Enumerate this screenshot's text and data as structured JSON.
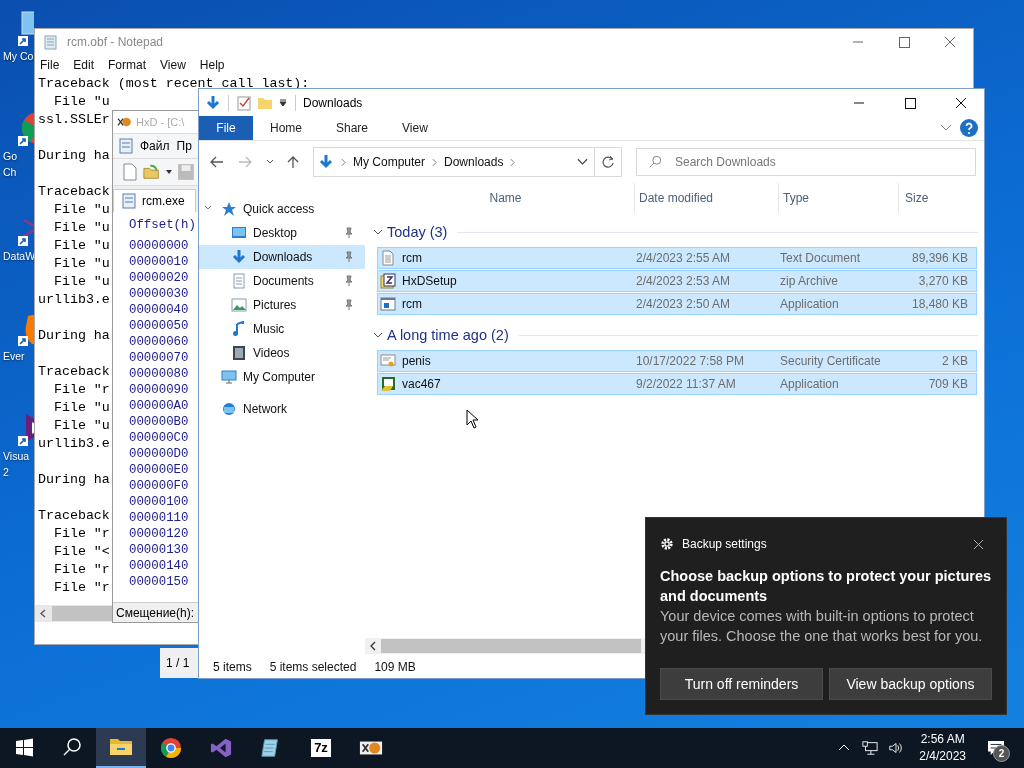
{
  "desktop_icons": [
    {
      "label_lines": [
        "My Co"
      ]
    },
    {
      "label_lines": [
        "Go",
        "Ch"
      ]
    },
    {
      "label_lines": [
        "DataW"
      ]
    },
    {
      "label_lines": [
        "Ever"
      ]
    },
    {
      "label_lines": [
        "Visua",
        "2"
      ]
    }
  ],
  "notepad": {
    "title": "rcm.obf - Notepad",
    "menu": [
      "File",
      "Edit",
      "Format",
      "View",
      "Help"
    ],
    "blocks": [
      [
        "Traceback (most recent call last):",
        "  File \"u",
        "ssl.SSLEr"
      ],
      [
        "During ha"
      ],
      [
        "Traceback",
        "  File \"u",
        "  File \"u",
        "  File \"u",
        "  File \"u",
        "  File \"u",
        "urllib3.e"
      ],
      [
        "During ha"
      ],
      [
        "Traceback",
        "  File \"r",
        "  File \"u",
        "  File \"u",
        "urllib3.e"
      ],
      [
        "During ha"
      ],
      [
        "Traceback",
        "  File \"r",
        "  File \"<",
        "  File \"r",
        "  File \"r"
      ]
    ]
  },
  "hxd": {
    "title": "HxD - [C:\\",
    "menu": [
      "Файл",
      "Пр"
    ],
    "tab": "rcm.exe",
    "offset_header": "Offset(h)",
    "offsets": [
      "00000000",
      "00000010",
      "00000020",
      "00000030",
      "00000040",
      "00000050",
      "00000060",
      "00000070",
      "00000080",
      "00000090",
      "000000A0",
      "000000B0",
      "000000C0",
      "000000D0",
      "000000E0",
      "000000F0",
      "00000100",
      "00000110",
      "00000120",
      "00000130",
      "00000140",
      "00000150"
    ],
    "status": "Смещение(h):",
    "page_status": "1 / 1"
  },
  "explorer": {
    "title": "Downloads",
    "ribbon_tabs": [
      {
        "label": "File",
        "selected": true
      },
      {
        "label": "Home",
        "selected": false
      },
      {
        "label": "Share",
        "selected": false
      },
      {
        "label": "View",
        "selected": false
      }
    ],
    "breadcrumb": [
      "My Computer",
      "Downloads"
    ],
    "search": {
      "placeholder": "Search Downloads"
    },
    "nav": [
      {
        "label": "Quick access",
        "expanded": true,
        "children": [
          {
            "label": "Desktop",
            "selected": false,
            "pinned": true
          },
          {
            "label": "Downloads",
            "selected": true,
            "pinned": true
          },
          {
            "label": "Documents",
            "selected": false,
            "pinned": true
          },
          {
            "label": "Pictures",
            "selected": false,
            "pinned": true
          },
          {
            "label": "Music",
            "selected": false,
            "pinned": false
          },
          {
            "label": "Videos",
            "selected": false,
            "pinned": false
          }
        ]
      },
      {
        "label": "My Computer"
      },
      {
        "label": "Network"
      }
    ],
    "columns": [
      "Name",
      "Date modified",
      "Type",
      "Size"
    ],
    "groups": [
      {
        "title": "Today (3)",
        "expanded": true,
        "rows": [
          {
            "kind": "text",
            "name": "rcm",
            "date": "2/4/2023 2:55 AM",
            "type": "Text Document",
            "size": "89,396 KB",
            "selected": true
          },
          {
            "kind": "zip",
            "name": "HxDSetup",
            "date": "2/4/2023 2:53 AM",
            "type": "zip Archive",
            "size": "3,270 KB",
            "selected": true
          },
          {
            "kind": "app",
            "name": "rcm",
            "date": "2/4/2023 2:50 AM",
            "type": "Application",
            "size": "18,480 KB",
            "selected": true
          }
        ]
      },
      {
        "title": "A long time ago (2)",
        "expanded": true,
        "rows": [
          {
            "kind": "cert",
            "name": "penis",
            "date": "10/17/2022 7:58 PM",
            "type": "Security Certificate",
            "size": "2 KB",
            "selected": true
          },
          {
            "kind": "setup",
            "name": "vac467",
            "date": "9/2/2022 11:37 AM",
            "type": "Application",
            "size": "709 KB",
            "selected": true
          }
        ]
      }
    ],
    "status": [
      "5 items",
      "5 items selected",
      "109 MB"
    ]
  },
  "toast": {
    "app": "Backup settings",
    "title": "Choose backup options to protect your pictures and documents",
    "body": "Your device comes with built-in options to protect your files. Choose the one that works best for you.",
    "buttons": [
      "Turn off reminders",
      "View backup options"
    ]
  },
  "taskbar": {
    "apps": [
      {
        "selected": true
      },
      {
        "selected": false
      },
      {
        "selected": false
      },
      {
        "selected": false
      },
      {
        "label": "7z",
        "selected": false
      },
      {
        "selected": false
      }
    ],
    "time": "2:56 AM",
    "date": "2/4/2023",
    "notifications": "2"
  }
}
